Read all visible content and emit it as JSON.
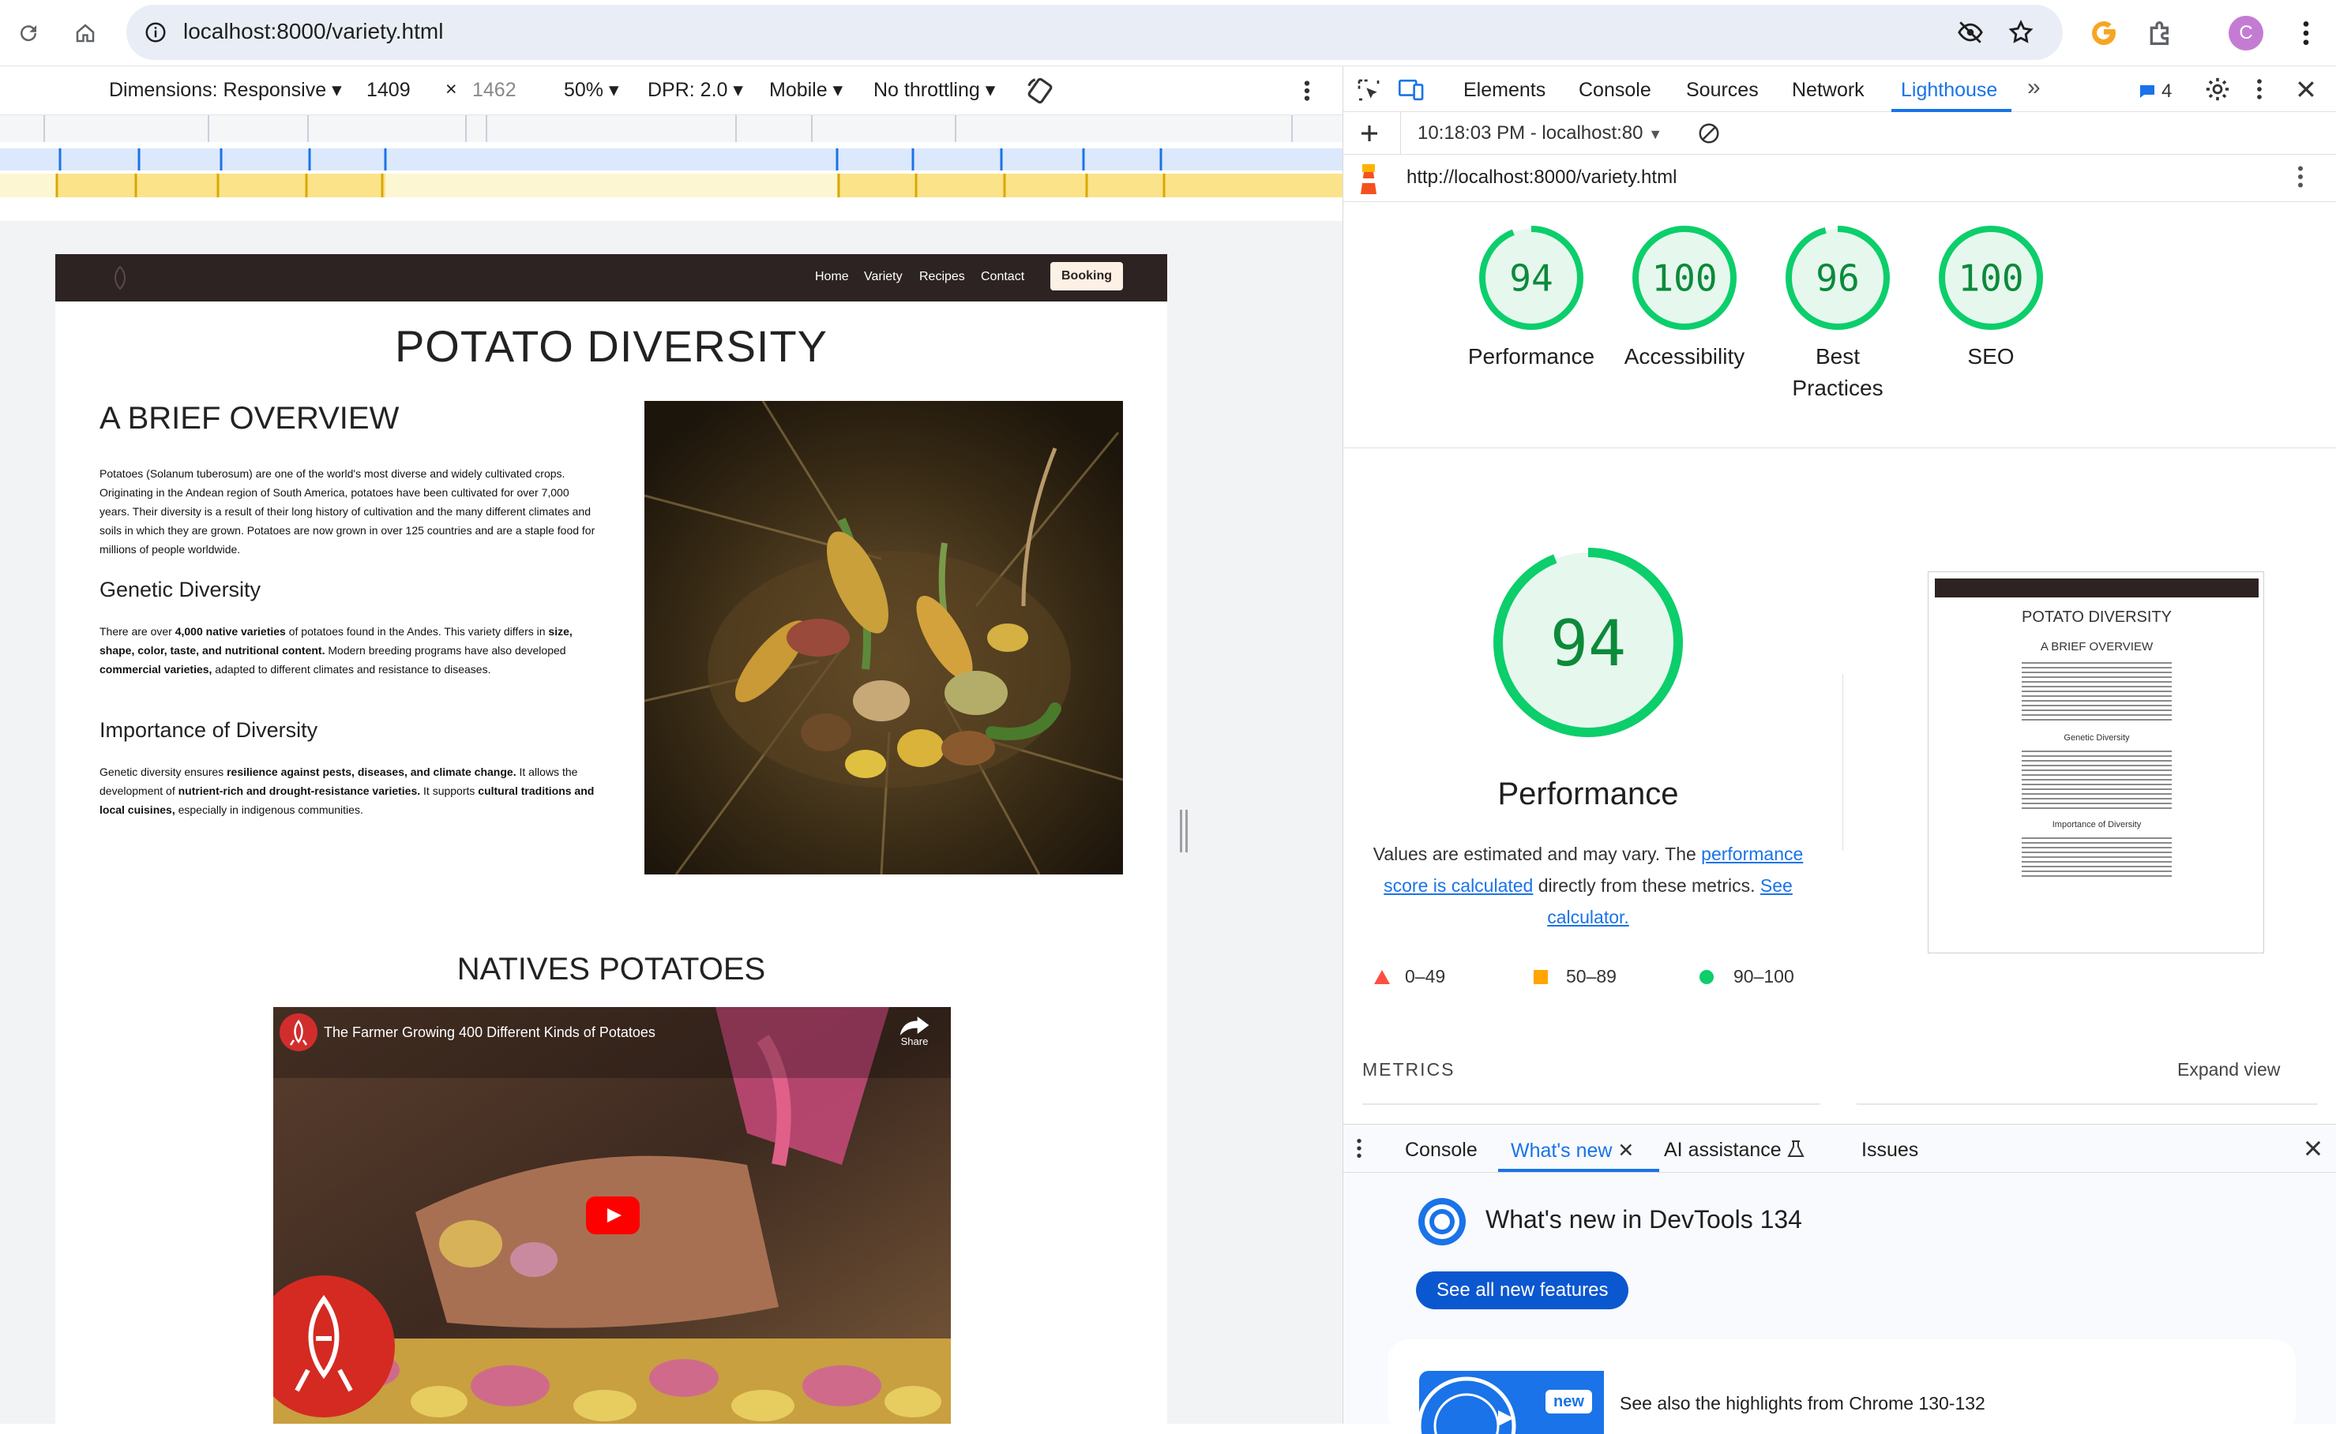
{
  "browser": {
    "url": "localhost:8000/variety.html",
    "profile_initial": "C"
  },
  "devbar": {
    "dimensions": "Dimensions: Responsive",
    "width": "1409",
    "height": "1462",
    "zoom": "50%",
    "dpr": "DPR: 2.0",
    "device": "Mobile",
    "throttle": "No throttling",
    "times": "×"
  },
  "site": {
    "nav": {
      "home": "Home",
      "variety": "Variety",
      "recipes": "Recipes",
      "contact": "Contact",
      "booking": "Booking"
    },
    "title": "POTATO DIVERSITY",
    "overview_heading": "A BRIEF OVERVIEW",
    "p1": "Potatoes (Solanum tuberosum) are one of the world's most diverse and widely cultivated crops. Originating in the Andean region of South America, potatoes have been cultivated for over 7,000 years. Their diversity is a result of their long history of cultivation and the many different climates and soils in which they are grown. Potatoes are now grown in over 125 countries and are a staple food for millions of people worldwide.",
    "genetic_heading": "Genetic Diversity",
    "p2_a": "There are over ",
    "p2_b": "4,000 native varieties",
    "p2_c": " of potatoes found in the Andes. This variety differs in ",
    "p2_d": "size, shape, color, taste, and nutritional content.",
    "p2_e": " Modern breeding programs have also developed ",
    "p2_f": "commercial varieties,",
    "p2_g": " adapted to different climates and resistance to diseases.",
    "importance_heading": "Importance of Diversity",
    "p3_a": "Genetic diversity ensures ",
    "p3_b": "resilience against pests, diseases, and climate change.",
    "p3_c": " It allows the development of ",
    "p3_d": "nutrient-rich and drought-resistance varieties.",
    "p3_e": " It supports ",
    "p3_f": "cultural traditions and local cuisines,",
    "p3_g": " especially in indigenous communities.",
    "natives_heading": "NATIVES POTATOES",
    "video_title": "The Farmer Growing 400 Different Kinds of Potatoes",
    "share": "Share"
  },
  "devtools": {
    "tabs": {
      "elements": "Elements",
      "console": "Console",
      "sources": "Sources",
      "network": "Network",
      "lighthouse": "Lighthouse",
      "more": "»",
      "issues_count": "4"
    },
    "lhbar": {
      "run": "10:18:03 PM - localhost:80"
    },
    "report_url": "http://localhost:8000/variety.html",
    "scores": [
      {
        "value": 94,
        "label": "Performance"
      },
      {
        "value": 100,
        "label": "Accessibility"
      },
      {
        "value": 96,
        "label": "Best Practices"
      },
      {
        "value": 100,
        "label": "SEO"
      }
    ],
    "big": {
      "value": 94,
      "label": "Performance",
      "note_a": "Values are estimated and may vary. The ",
      "note_link": "performance score is calculated",
      "note_b": " directly from these metrics. ",
      "note_link2": "See calculator."
    },
    "legend": {
      "fail": "0–49",
      "average": "50–89",
      "pass": "90–100"
    },
    "metrics": "METRICS",
    "expand": "Expand view",
    "thumb": {
      "title": "POTATO DIVERSITY",
      "h2": "A BRIEF OVERVIEW",
      "h3a": "Genetic Diversity",
      "h3b": "Importance of Diversity"
    },
    "drawer": {
      "console": "Console",
      "whatsnew": "What's new",
      "ai": "AI assistance",
      "issues": "Issues",
      "headline": "What's new in DevTools 134",
      "button": "See all new features",
      "badge": "new",
      "highlights": "See also the highlights from Chrome 130-132"
    },
    "colors": {
      "pass": "#0cce6b",
      "pass_text": "#0c8a3a",
      "average": "#ffa400",
      "fail": "#ff4e42",
      "accent": "#1a73e8"
    }
  }
}
